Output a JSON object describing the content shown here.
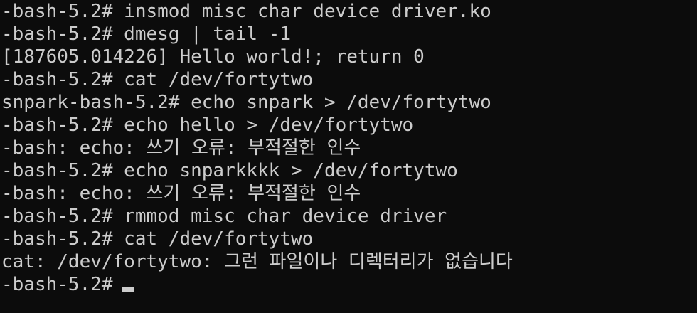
{
  "terminal": {
    "lines": [
      "-bash-5.2# insmod misc_char_device_driver.ko",
      "-bash-5.2# dmesg | tail -1",
      "[187605.014226] Hello world!; return 0",
      "-bash-5.2# cat /dev/fortytwo",
      "snpark-bash-5.2# echo snpark > /dev/fortytwo",
      "-bash-5.2# echo hello > /dev/fortytwo",
      "-bash: echo: 쓰기 오류: 부적절한 인수",
      "-bash-5.2# echo snparkkkk > /dev/fortytwo",
      "-bash: echo: 쓰기 오류: 부적절한 인수",
      "-bash-5.2# rmmod misc_char_device_driver",
      "-bash-5.2# cat /dev/fortytwo",
      "cat: /dev/fortytwo: 그런 파일이나 디렉터리가 없습니다"
    ],
    "prompt": "-bash-5.2#"
  },
  "colors": {
    "background": "#0c0c0c",
    "foreground": "#cccccc"
  }
}
